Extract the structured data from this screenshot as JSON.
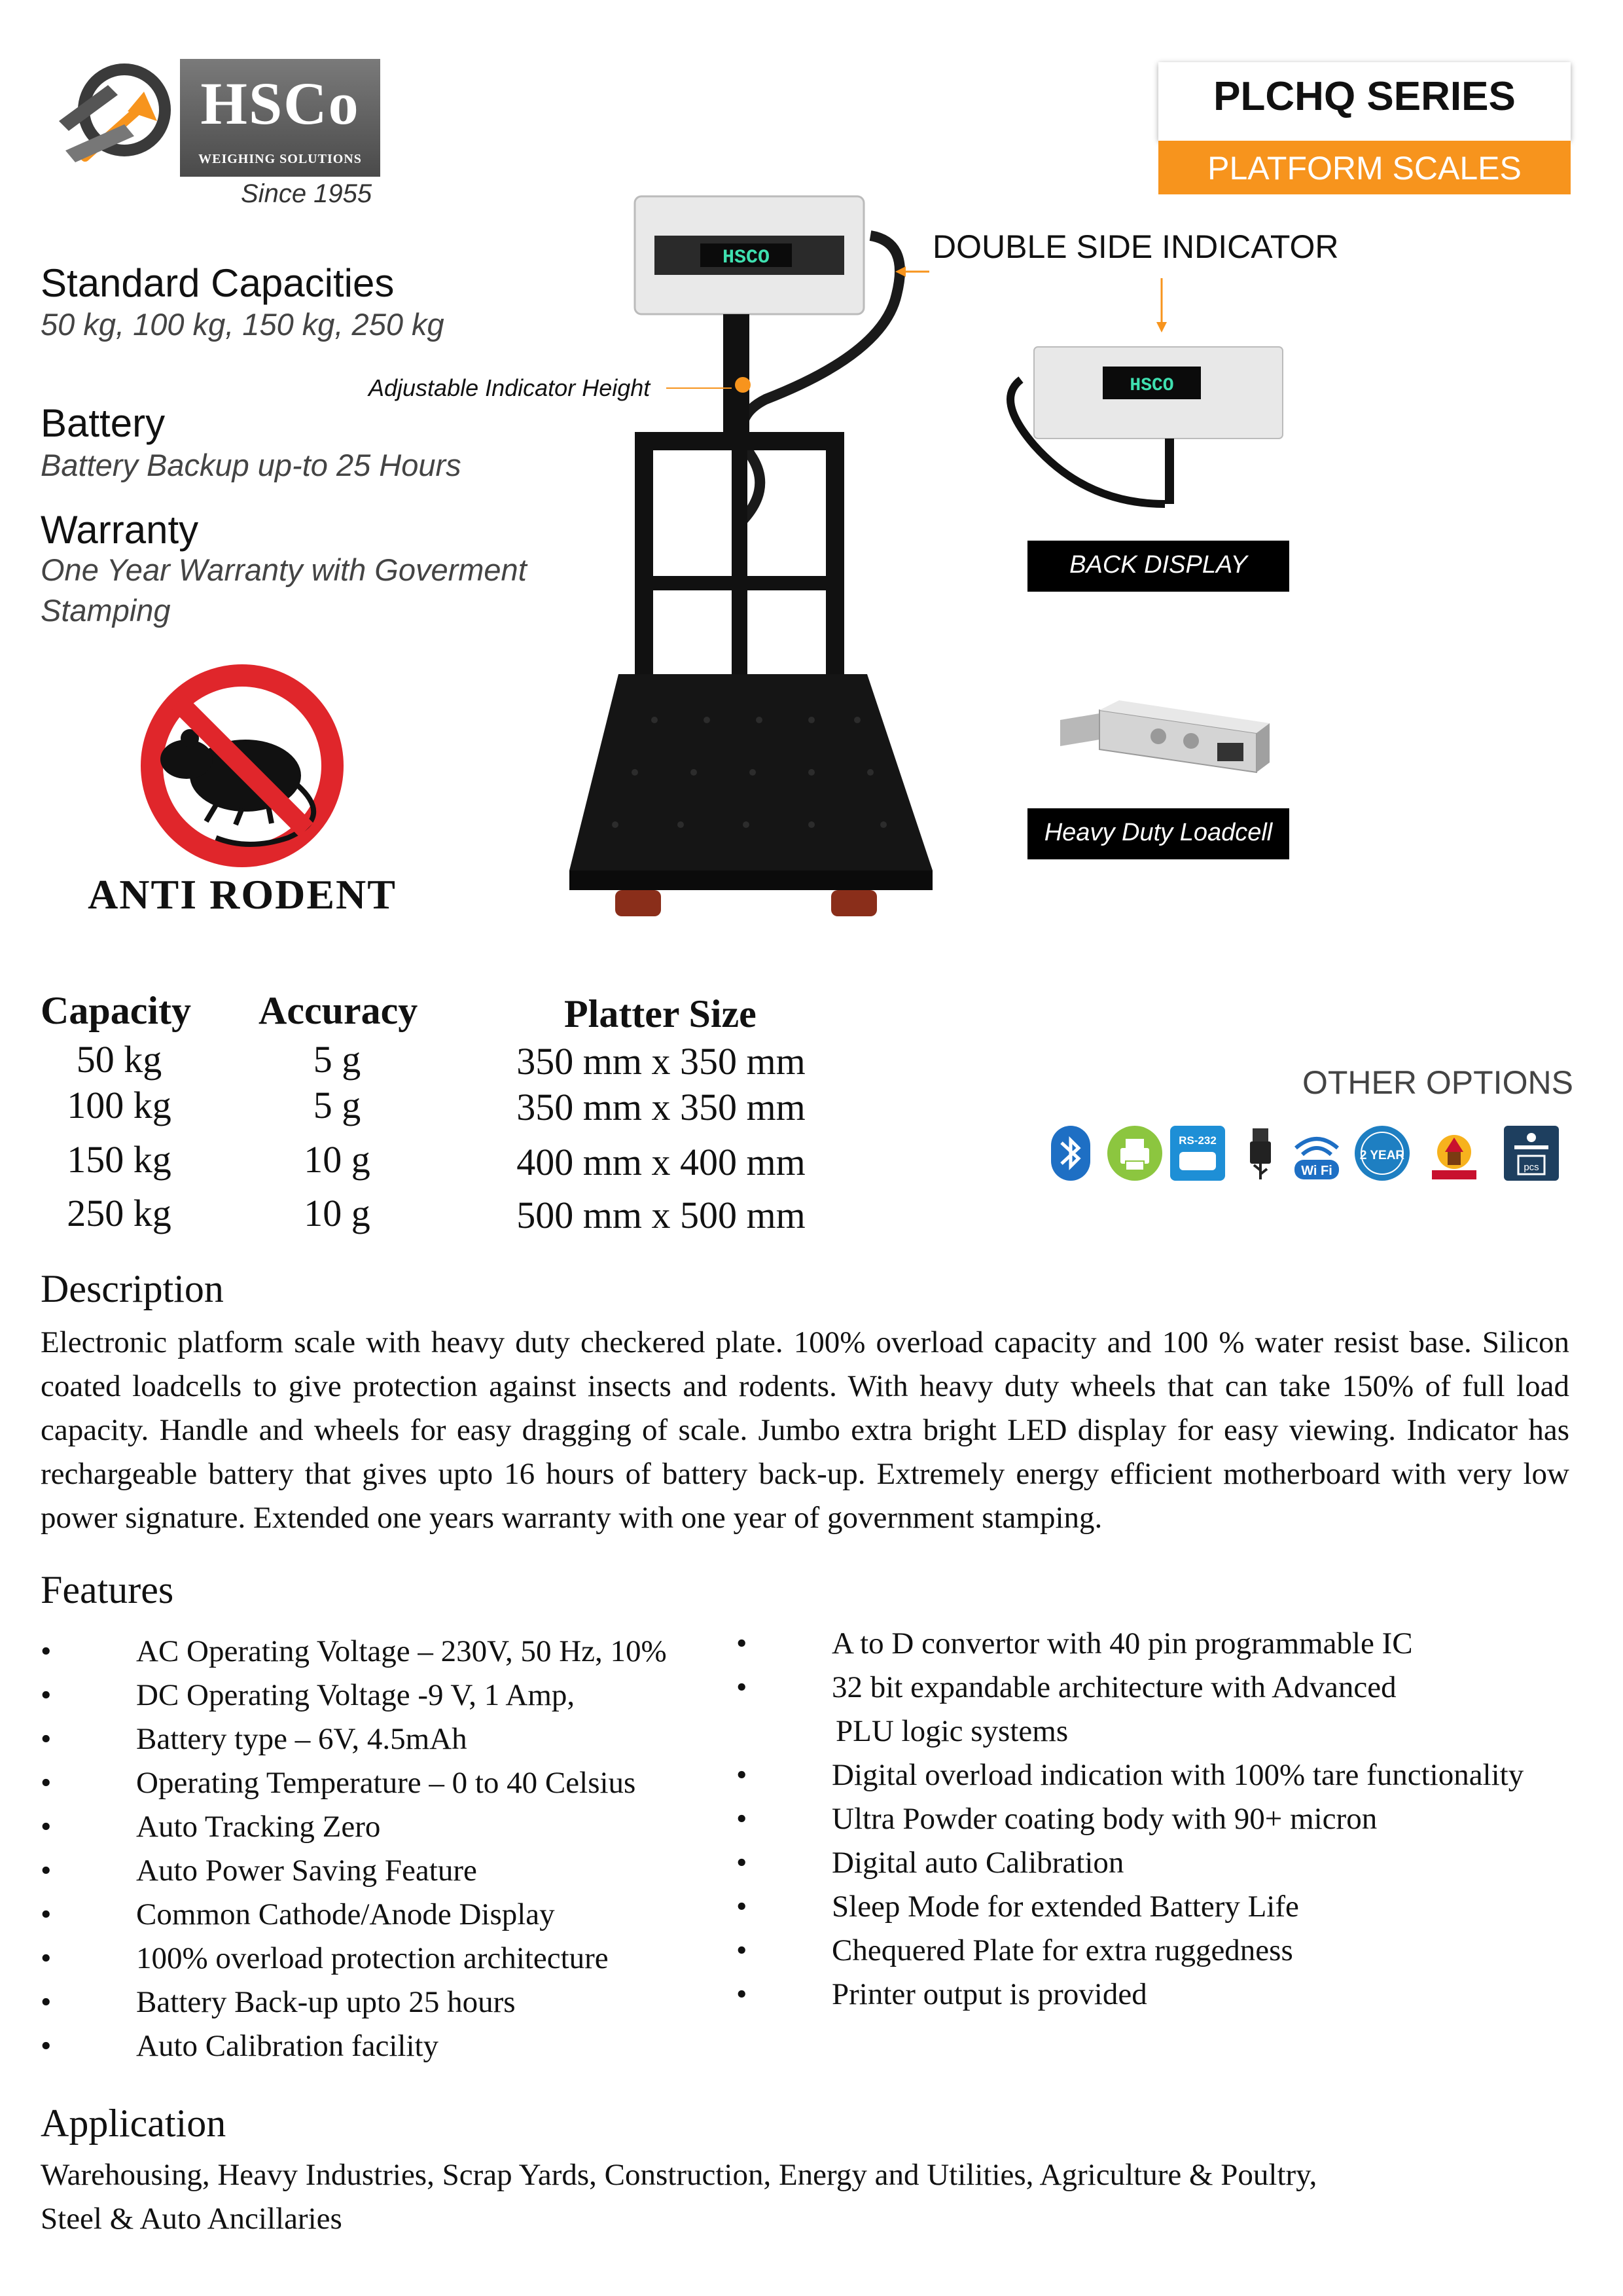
{
  "brand": {
    "logo_text": "HSCo",
    "logo_subtext": "WEIGHING SOLUTIONS",
    "since": "Since 1955"
  },
  "series": {
    "title": "PLCHQ SERIES",
    "subtitle": "PLATFORM SCALES"
  },
  "specs_left": {
    "capacities_heading": "Standard Capacities",
    "capacities_value": "50 kg, 100 kg, 150 kg, 250 kg",
    "battery_heading": "Battery",
    "battery_value": "Battery Backup up-to 25 Hours",
    "warranty_heading": "Warranty",
    "warranty_value": "One Year Warranty with Goverment Stamping"
  },
  "badges": {
    "anti_rodent": "ANTI RODENT"
  },
  "product_callouts": {
    "adjustable_height": "Adjustable Indicator Height",
    "double_side_indicator": "DOUBLE SIDE INDICATOR",
    "back_display": "BACK DISPLAY",
    "loadcell": "Heavy Duty Loadcell",
    "display_reading": "HSCO"
  },
  "spec_table": {
    "headers": {
      "capacity": "Capacity",
      "accuracy": "Accuracy",
      "platter": "Platter Size"
    },
    "rows": [
      {
        "capacity": "50 kg",
        "accuracy": "5 g",
        "platter": "350 mm x 350 mm"
      },
      {
        "capacity": "100 kg",
        "accuracy": "5 g",
        "platter": "350 mm x 350 mm"
      },
      {
        "capacity": "150 kg",
        "accuracy": "10 g",
        "platter": "400 mm x 400 mm"
      },
      {
        "capacity": "250 kg",
        "accuracy": "10 g",
        "platter": "500 mm x 500 mm"
      }
    ]
  },
  "other_options": {
    "label": "OTHER OPTIONS",
    "icons": [
      "bluetooth-icon",
      "printer-icon",
      "rs232-icon",
      "usb-icon",
      "wifi-icon",
      "two-year-warranty-icon",
      "government-stamp-icon",
      "pcs-counting-icon"
    ],
    "icon_texts": {
      "rs232": "RS-232",
      "wifi": "Wi Fi",
      "warranty": "2 YEAR",
      "pcs": "pcs"
    }
  },
  "description": {
    "heading": "Description",
    "body": "Electronic platform scale with heavy duty checkered plate. 100% overload capacity and 100 % water resist base. Silicon coated loadcells to give protection against insects and rodents. With heavy duty wheels that can take 150% of full load capacity. Handle and wheels for easy dragging of scale. Jumbo extra bright LED display for easy viewing. Indicator has rechargeable battery that gives upto 16 hours of battery back-up. Extremely energy efficient motherboard with very low power signature. Extended one years warranty with one year of government stamping."
  },
  "features": {
    "heading": "Features",
    "bullet": "•",
    "left": [
      "AC Operating Voltage – 230V, 50 Hz, 10%",
      "DC Operating Voltage -9 V, 1 Amp,",
      "Battery type – 6V, 4.5mAh",
      "Operating Temperature – 0 to 40 Celsius",
      "Auto Tracking Zero",
      "Auto Power Saving Feature",
      "Common Cathode/Anode Display",
      "100% overload protection architecture",
      "Battery Back-up upto 25 hours",
      "Auto Calibration facility"
    ],
    "right": [
      "A to D convertor with 40 pin programmable IC",
      "32 bit expandable architecture with Advanced",
      "PLU logic systems",
      "Digital overload indication with 100% tare functionality",
      "Ultra Powder coating body with 90+ micron",
      "Digital auto Calibration",
      "Sleep Mode for extended Battery Life",
      "Chequered Plate for extra ruggedness",
      "Printer output is provided"
    ]
  },
  "application": {
    "heading": "Application",
    "line1": "Warehousing, Heavy Industries, Scrap Yards, Construction, Energy and Utilities, Agriculture & Poultry,",
    "line2": "Steel & Auto Ancillaries"
  },
  "colors": {
    "accent_orange": "#f7941d",
    "badge_black": "#000000",
    "rodent_red": "#e0262b",
    "display_green": "#3fe0b0"
  }
}
